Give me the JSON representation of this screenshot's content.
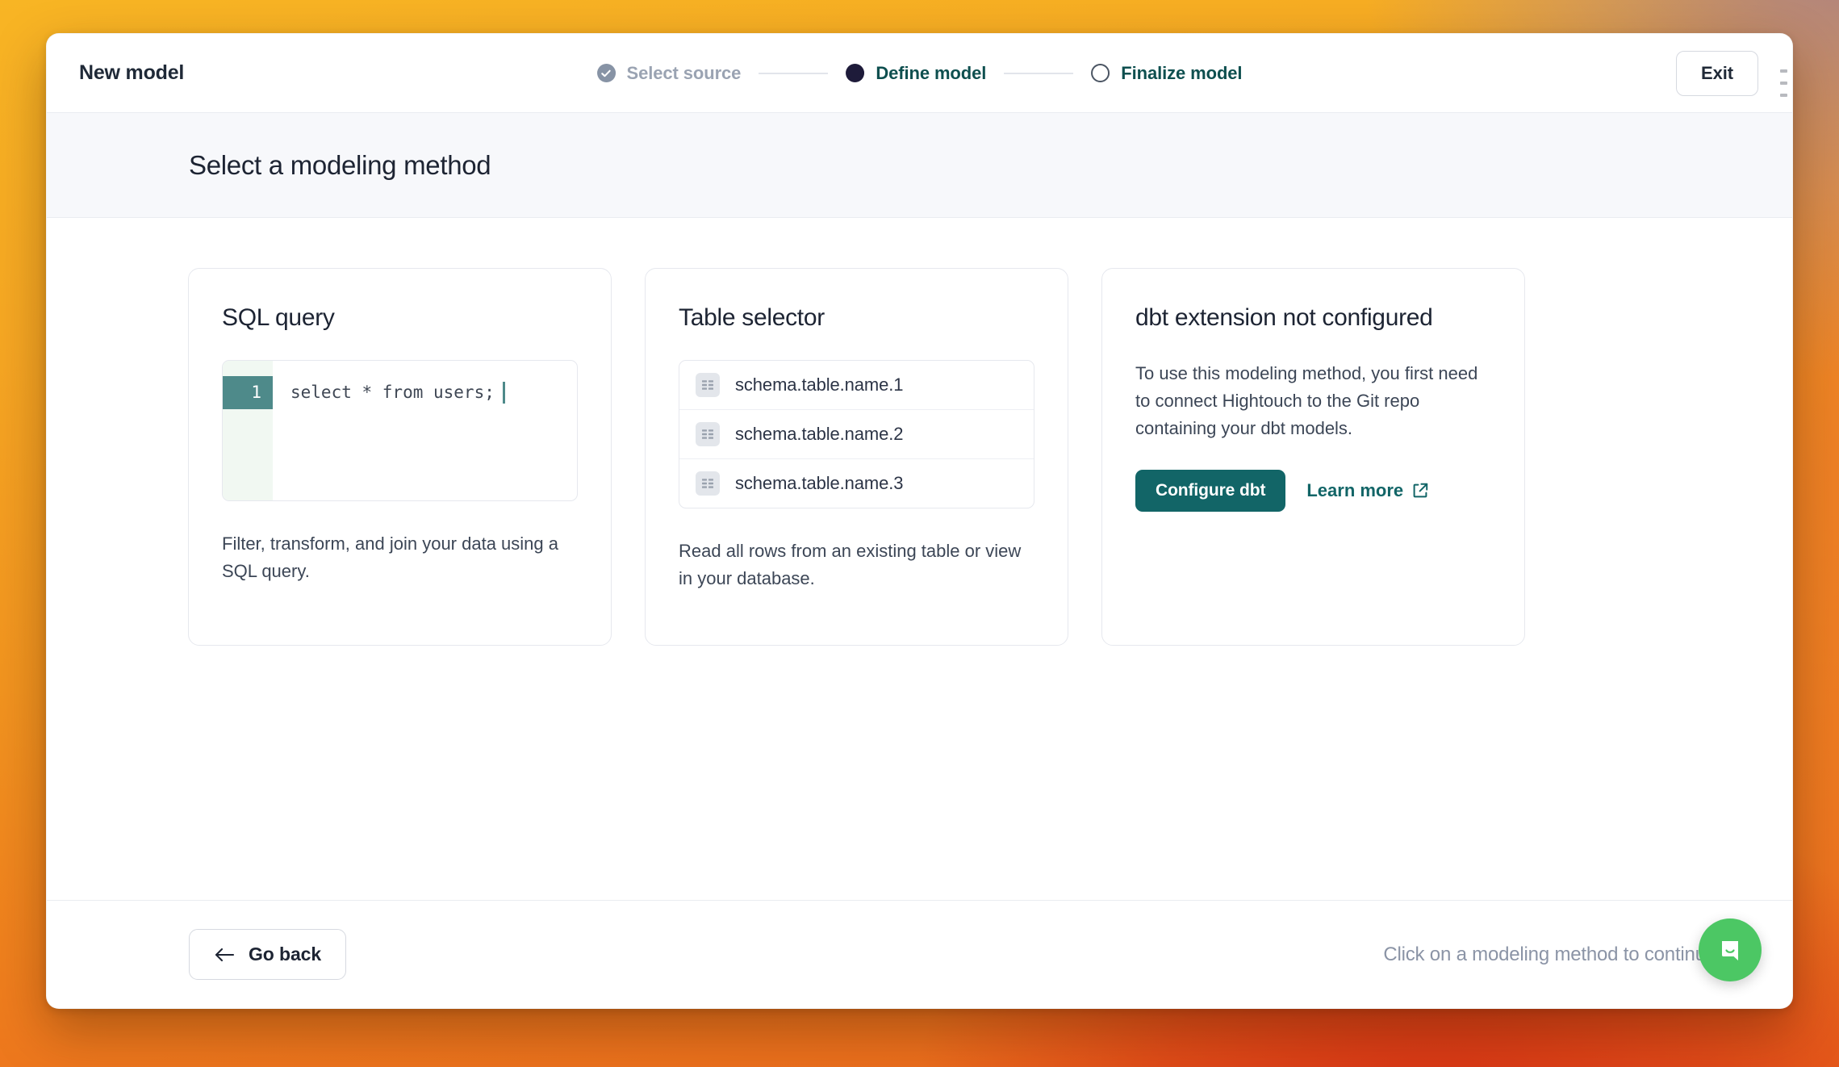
{
  "window": {
    "title": "New model",
    "exit_label": "Exit"
  },
  "stepper": {
    "steps": [
      {
        "label": "Select source",
        "state": "done"
      },
      {
        "label": "Define model",
        "state": "current"
      },
      {
        "label": "Finalize model",
        "state": "todo"
      }
    ]
  },
  "subheader": {
    "heading": "Select a modeling method"
  },
  "cards": {
    "sql": {
      "title": "SQL query",
      "code": "select * from users;",
      "line_number": "1",
      "description": "Filter, transform, and join your data using a SQL query."
    },
    "table": {
      "title": "Table selector",
      "rows": [
        "schema.table.name.1",
        "schema.table.name.2",
        "schema.table.name.3"
      ],
      "description": "Read all rows from an existing table or view in your database."
    },
    "dbt": {
      "title": "dbt extension not configured",
      "description": "To use this modeling method, you first need to connect Hightouch to the Git repo containing your dbt models.",
      "primary_label": "Configure dbt",
      "link_label": "Learn more"
    }
  },
  "footer": {
    "back_label": "Go back",
    "hint": "Click on a modeling method to continue"
  },
  "colors": {
    "accent_teal": "#126567",
    "step_current": "#1E1B3A",
    "step_done": "#8793A5",
    "chat_green": "#4CC764",
    "editor_active_line": "#4E8A8A"
  }
}
